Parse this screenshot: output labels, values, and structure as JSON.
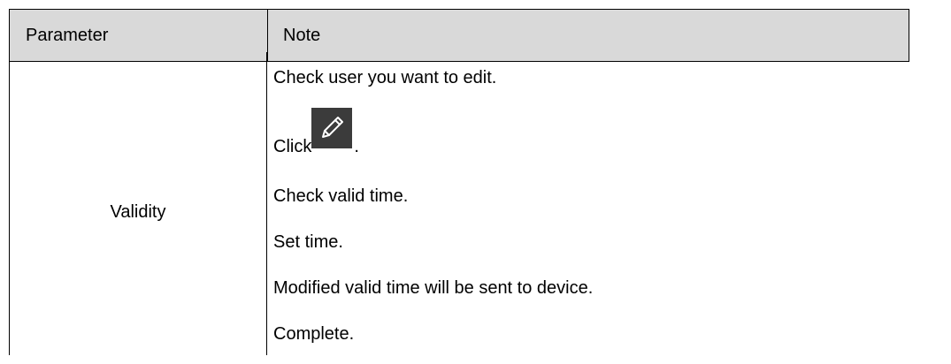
{
  "table": {
    "header": {
      "parameter": "Parameter",
      "note": "Note"
    },
    "rows": [
      {
        "parameter": "Validity",
        "steps": [
          "Check user you want to edit.",
          "Click",
          "Check valid time.",
          "Set time.",
          "Modified valid time will be sent to device.",
          "Complete."
        ],
        "step2_suffix": ".",
        "step2_icon": "edit-pencil-icon"
      }
    ]
  },
  "colors": {
    "header_bg": "#d9d9d9",
    "border": "#000000",
    "icon_bg": "#3b3b3b",
    "icon_stroke": "#ffffff"
  }
}
